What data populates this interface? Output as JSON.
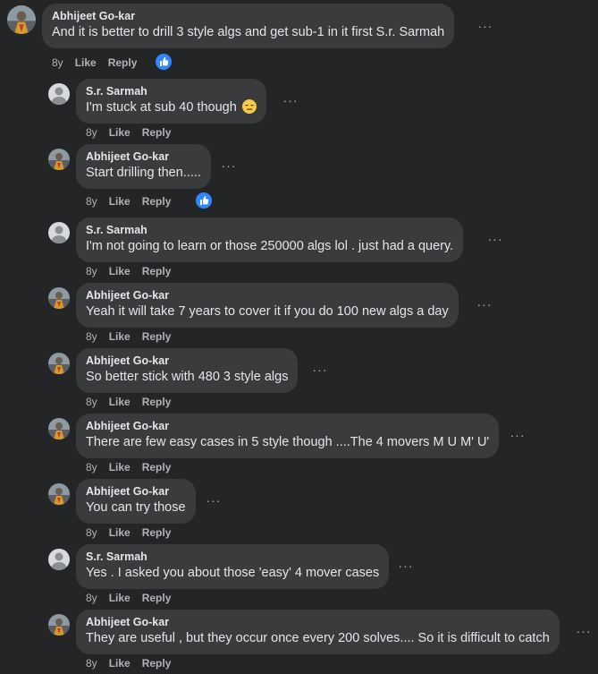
{
  "colors": {
    "background": "#242526",
    "bubble": "#3a3b3c",
    "text": "#e4e6eb",
    "secondary": "#b0b3b8",
    "like_blue": "#2d88ff"
  },
  "actions": {
    "like": "Like",
    "reply": "Reply",
    "more": "···"
  },
  "comments": [
    {
      "author": "Abhijeet Go-kar",
      "text": "And it is better to drill 3 style algs and get sub-1 in it first S.r. Sarmah",
      "age": "8y",
      "liked": true,
      "avatar": "photo"
    },
    {
      "author": "S.r. Sarmah",
      "text": "I'm stuck at sub 40 though",
      "emoji": "expressionless-face",
      "age": "8y",
      "avatar": "default"
    },
    {
      "author": "Abhijeet Go-kar",
      "text": "Start drilling then.....",
      "age": "8y",
      "liked": true,
      "avatar": "photo"
    },
    {
      "author": "S.r. Sarmah",
      "text": "I'm not going to learn or those 250000 algs lol . just had a query.",
      "age": "8y",
      "avatar": "default"
    },
    {
      "author": "Abhijeet Go-kar",
      "text": "Yeah it will take 7 years to cover it if you do 100 new algs a day",
      "age": "8y",
      "avatar": "photo"
    },
    {
      "author": "Abhijeet Go-kar",
      "text": "So better stick with 480 3 style algs",
      "age": "8y",
      "avatar": "photo"
    },
    {
      "author": "Abhijeet Go-kar",
      "text": "There are few easy cases in 5 style though ....The 4 movers M U M' U'",
      "age": "8y",
      "avatar": "photo"
    },
    {
      "author": "Abhijeet Go-kar",
      "text": "You can try those",
      "age": "8y",
      "avatar": "photo"
    },
    {
      "author": "S.r. Sarmah",
      "text": "Yes . I asked you about those 'easy' 4 mover cases",
      "age": "8y",
      "avatar": "default"
    },
    {
      "author": "Abhijeet Go-kar",
      "text": "They are useful , but they occur once every 200 solves.... So it is difficult to catch",
      "age": "8y",
      "avatar": "photo"
    }
  ]
}
